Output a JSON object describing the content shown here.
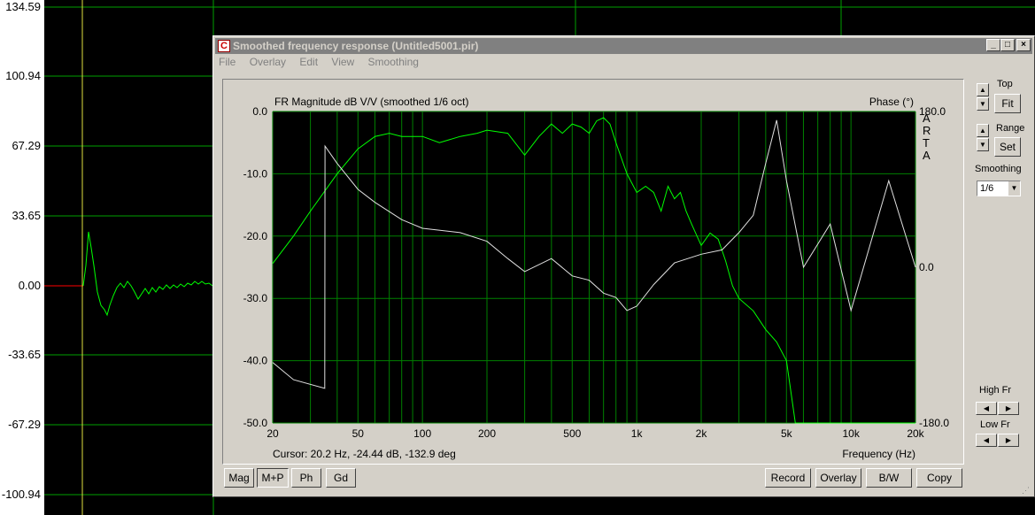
{
  "background": {
    "y_axis_labels": [
      "134.59",
      "100.94",
      "67.29",
      "33.65",
      "0.00",
      "-33.65",
      "-67.29",
      "-100.94"
    ]
  },
  "window": {
    "title": "Smoothed frequency response (Untitled5001.pir)",
    "app_icon_glyph": "C",
    "controls": {
      "minimize": "_",
      "maximize": "□",
      "close": "×"
    },
    "menu": [
      "File",
      "Overlay",
      "Edit",
      "View",
      "Smoothing"
    ]
  },
  "plot": {
    "title_left": "FR Magnitude dB V/V (smoothed 1/6 oct)",
    "title_right": "Phase (°)",
    "brand": [
      "A",
      "R",
      "T",
      "A"
    ],
    "y_left_ticks": [
      "0.0",
      "-10.0",
      "-20.0",
      "-30.0",
      "-40.0",
      "-50.0"
    ],
    "y_right_ticks": [
      "180.0",
      "0.0",
      "-180.0"
    ],
    "x_ticks": [
      "20",
      "50",
      "100",
      "200",
      "500",
      "1k",
      "2k",
      "5k",
      "10k",
      "20k"
    ],
    "cursor_text": "Cursor: 20.2 Hz, -24.44 dB, -132.9 deg",
    "x_axis_label": "Frequency (Hz)"
  },
  "chart_data": {
    "type": "line",
    "x_scale": "log",
    "xlim": [
      20,
      20000
    ],
    "ylim_left": [
      -50,
      0
    ],
    "ylim_right": [
      -180,
      180
    ],
    "series": [
      {
        "color": "#00ff00",
        "axis": "left",
        "x": [
          20,
          25,
          30,
          40,
          50,
          60,
          70,
          80,
          100,
          120,
          150,
          180,
          200,
          250,
          300,
          350,
          400,
          450,
          500,
          550,
          600,
          650,
          700,
          750,
          800,
          900,
          1000,
          1100,
          1200,
          1300,
          1400,
          1500,
          1600,
          1700,
          1800,
          2000,
          2200,
          2400,
          2600,
          2800,
          3000,
          3500,
          4000,
          4500,
          5000,
          5500,
          6000,
          8000,
          10000,
          15000,
          20000
        ],
        "y": [
          -24.4,
          -20,
          -16,
          -10,
          -6,
          -4,
          -3.5,
          -4,
          -4,
          -5,
          -4,
          -3.5,
          -3,
          -3.5,
          -7,
          -4,
          -2,
          -3.5,
          -2,
          -2.5,
          -3.5,
          -1.5,
          -1,
          -2,
          -5,
          -10,
          -13,
          -12,
          -13,
          -16,
          -12,
          -14,
          -13,
          -16,
          -18,
          -21.5,
          -19.5,
          -20.5,
          -24,
          -28,
          -30,
          -32,
          -35,
          -37,
          -40,
          -50,
          -55,
          -52,
          -50,
          -50,
          -50
        ]
      },
      {
        "color": "#e0e0e0",
        "axis": "right",
        "x": [
          20,
          25,
          35,
          35.1,
          40,
          50,
          60,
          80,
          100,
          150,
          200,
          250,
          300,
          400,
          500,
          600,
          700,
          800,
          900,
          1000,
          1200,
          1500,
          2000,
          2500,
          3000,
          3500,
          4000,
          4500,
          5000,
          6000,
          8000,
          10000,
          15000,
          20000
        ],
        "y": [
          -110,
          -130,
          -140,
          140,
          120,
          90,
          75,
          55,
          45,
          40,
          30,
          10,
          -5,
          10,
          -10,
          -15,
          -30,
          -35,
          -50,
          -45,
          -20,
          5,
          15,
          20,
          40,
          60,
          120,
          170,
          100,
          0,
          50,
          -50,
          100,
          0
        ]
      }
    ]
  },
  "right_panel": {
    "top_label": "Top",
    "fit_label": "Fit",
    "range_label": "Range",
    "set_label": "Set",
    "smoothing_label": "Smoothing",
    "smoothing_value": "1/6",
    "high_fr_label": "High Fr",
    "low_fr_label": "Low Fr"
  },
  "bottom_buttons": {
    "mag": "Mag",
    "mp": "M+P",
    "ph": "Ph",
    "gd": "Gd",
    "record": "Record",
    "overlay": "Overlay",
    "bw": "B/W",
    "copy": "Copy"
  }
}
